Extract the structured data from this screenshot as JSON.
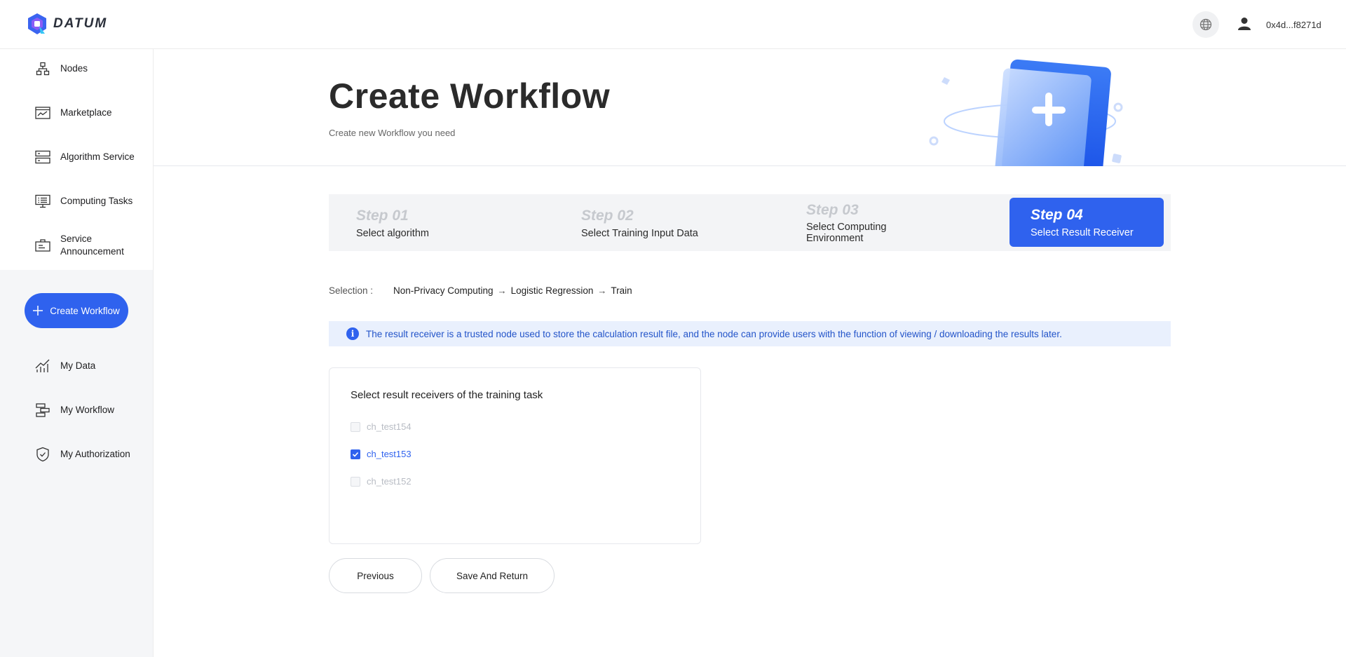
{
  "header": {
    "logo_text": "DATUM",
    "address": "0x4d...f8271d"
  },
  "sidebar": {
    "items": [
      {
        "label": "Nodes",
        "icon": "nodes-icon"
      },
      {
        "label": "Marketplace",
        "icon": "marketplace-icon"
      },
      {
        "label": "Algorithm Service",
        "icon": "algorithm-icon"
      },
      {
        "label": "Computing Tasks",
        "icon": "computing-icon"
      },
      {
        "label": "Service Announcement",
        "icon": "announcement-icon"
      },
      {
        "label": "My Data",
        "icon": "chart-icon"
      },
      {
        "label": "My Workflow",
        "icon": "workflow-icon"
      },
      {
        "label": "My Authorization",
        "icon": "shield-icon"
      }
    ],
    "create_button": "Create Workflow"
  },
  "banner": {
    "title": "Create Workflow",
    "subtitle": "Create new Workflow you need"
  },
  "steps": [
    {
      "num": "Step  01",
      "label": "Select algorithm"
    },
    {
      "num": "Step  02",
      "label": "Select Training Input Data"
    },
    {
      "num": "Step  03",
      "label": "Select Computing Environment"
    },
    {
      "num": "Step  04",
      "label": "Select Result Receiver"
    }
  ],
  "selection": {
    "label": "Selection :",
    "path": [
      "Non-Privacy Computing",
      "Logistic Regression",
      "Train"
    ]
  },
  "info": {
    "text": "The result receiver is a trusted node used to store the calculation result file, and the node can provide users with the function of viewing / downloading the results later."
  },
  "receivers": {
    "title": "Select result receivers of the training task",
    "options": [
      {
        "label": "ch_test154",
        "state": "disabled"
      },
      {
        "label": "ch_test153",
        "state": "checked"
      },
      {
        "label": "ch_test152",
        "state": "disabled"
      }
    ]
  },
  "buttons": {
    "previous": "Previous",
    "save": "Save And Return"
  },
  "colors": {
    "accent": "#2f62ee",
    "info_bg": "#e9f0fd"
  }
}
